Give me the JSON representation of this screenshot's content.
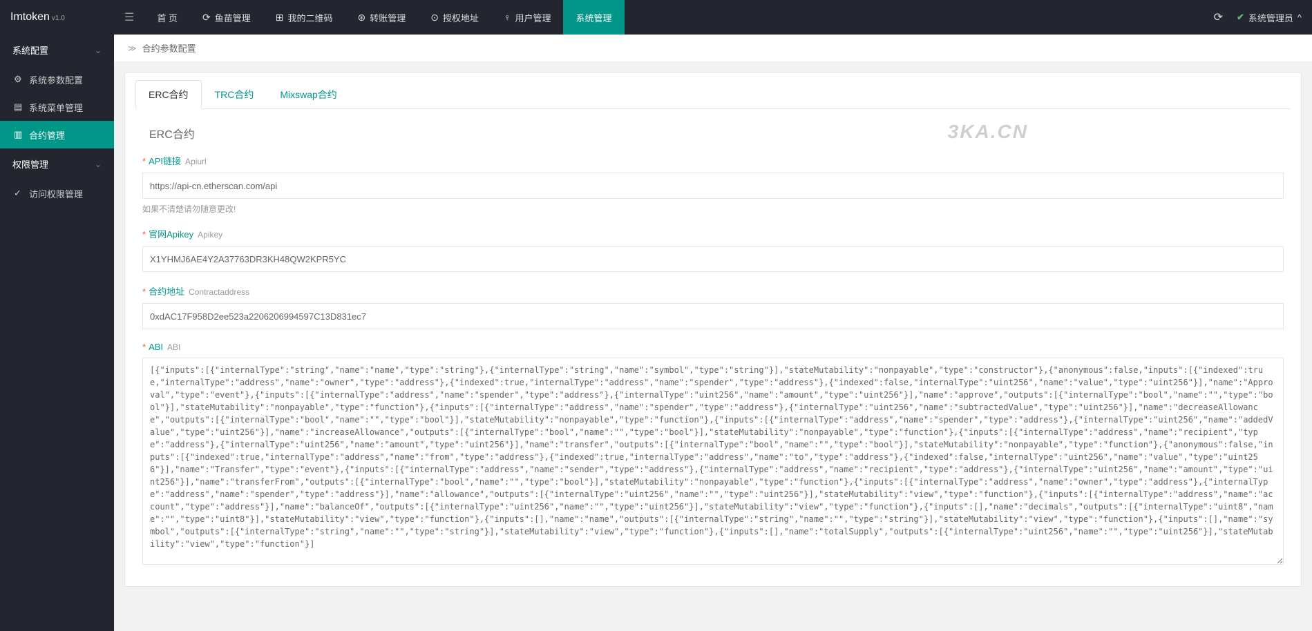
{
  "app": {
    "name": "Imtoken",
    "version": "v1.0"
  },
  "header": {
    "nav": [
      {
        "icon": "",
        "label": "首 页"
      },
      {
        "icon": "⟳",
        "label": "鱼苗管理"
      },
      {
        "icon": "⊞",
        "label": "我的二维码"
      },
      {
        "icon": "⊛",
        "label": "转账管理"
      },
      {
        "icon": "⊙",
        "label": "授权地址"
      },
      {
        "icon": "♀",
        "label": "用户管理"
      },
      {
        "icon": "",
        "label": "系统管理"
      }
    ],
    "user": "系统管理员"
  },
  "sidebar": {
    "group1": {
      "title": "系统配置"
    },
    "items1": [
      {
        "icon": "⚙",
        "label": "系统参数配置"
      },
      {
        "icon": "▤",
        "label": "系统菜单管理"
      },
      {
        "icon": "▥",
        "label": "合约管理"
      }
    ],
    "group2": {
      "title": "权限管理"
    },
    "items2": [
      {
        "icon": "✓",
        "label": "访问权限管理"
      }
    ]
  },
  "breadcrumb": "合约参数配置",
  "tabs": [
    {
      "label": "ERC合约"
    },
    {
      "label": "TRC合约"
    },
    {
      "label": "Mixswap合约"
    }
  ],
  "form": {
    "title": "ERC合约",
    "fields": {
      "apiurl": {
        "label": "API链接",
        "sub": "Apiurl",
        "value": "https://api-cn.etherscan.com/api",
        "hint": "如果不清楚请勿随意更改!"
      },
      "apikey": {
        "label": "官网Apikey",
        "sub": "Apikey",
        "value": "X1YHMJ6AE4Y2A37763DR3KH48QW2KPR5YC"
      },
      "contract": {
        "label": "合约地址",
        "sub": "Contractaddress",
        "value": "0xdAC17F958D2ee523a2206206994597C13D831ec7"
      },
      "abi": {
        "label": "ABI",
        "sub": "ABI",
        "value": "[{\"inputs\":[{\"internalType\":\"string\",\"name\":\"name\",\"type\":\"string\"},{\"internalType\":\"string\",\"name\":\"symbol\",\"type\":\"string\"}],\"stateMutability\":\"nonpayable\",\"type\":\"constructor\"},{\"anonymous\":false,\"inputs\":[{\"indexed\":true,\"internalType\":\"address\",\"name\":\"owner\",\"type\":\"address\"},{\"indexed\":true,\"internalType\":\"address\",\"name\":\"spender\",\"type\":\"address\"},{\"indexed\":false,\"internalType\":\"uint256\",\"name\":\"value\",\"type\":\"uint256\"}],\"name\":\"Approval\",\"type\":\"event\"},{\"inputs\":[{\"internalType\":\"address\",\"name\":\"spender\",\"type\":\"address\"},{\"internalType\":\"uint256\",\"name\":\"amount\",\"type\":\"uint256\"}],\"name\":\"approve\",\"outputs\":[{\"internalType\":\"bool\",\"name\":\"\",\"type\":\"bool\"}],\"stateMutability\":\"nonpayable\",\"type\":\"function\"},{\"inputs\":[{\"internalType\":\"address\",\"name\":\"spender\",\"type\":\"address\"},{\"internalType\":\"uint256\",\"name\":\"subtractedValue\",\"type\":\"uint256\"}],\"name\":\"decreaseAllowance\",\"outputs\":[{\"internalType\":\"bool\",\"name\":\"\",\"type\":\"bool\"}],\"stateMutability\":\"nonpayable\",\"type\":\"function\"},{\"inputs\":[{\"internalType\":\"address\",\"name\":\"spender\",\"type\":\"address\"},{\"internalType\":\"uint256\",\"name\":\"addedValue\",\"type\":\"uint256\"}],\"name\":\"increaseAllowance\",\"outputs\":[{\"internalType\":\"bool\",\"name\":\"\",\"type\":\"bool\"}],\"stateMutability\":\"nonpayable\",\"type\":\"function\"},{\"inputs\":[{\"internalType\":\"address\",\"name\":\"recipient\",\"type\":\"address\"},{\"internalType\":\"uint256\",\"name\":\"amount\",\"type\":\"uint256\"}],\"name\":\"transfer\",\"outputs\":[{\"internalType\":\"bool\",\"name\":\"\",\"type\":\"bool\"}],\"stateMutability\":\"nonpayable\",\"type\":\"function\"},{\"anonymous\":false,\"inputs\":[{\"indexed\":true,\"internalType\":\"address\",\"name\":\"from\",\"type\":\"address\"},{\"indexed\":true,\"internalType\":\"address\",\"name\":\"to\",\"type\":\"address\"},{\"indexed\":false,\"internalType\":\"uint256\",\"name\":\"value\",\"type\":\"uint256\"}],\"name\":\"Transfer\",\"type\":\"event\"},{\"inputs\":[{\"internalType\":\"address\",\"name\":\"sender\",\"type\":\"address\"},{\"internalType\":\"address\",\"name\":\"recipient\",\"type\":\"address\"},{\"internalType\":\"uint256\",\"name\":\"amount\",\"type\":\"uint256\"}],\"name\":\"transferFrom\",\"outputs\":[{\"internalType\":\"bool\",\"name\":\"\",\"type\":\"bool\"}],\"stateMutability\":\"nonpayable\",\"type\":\"function\"},{\"inputs\":[{\"internalType\":\"address\",\"name\":\"owner\",\"type\":\"address\"},{\"internalType\":\"address\",\"name\":\"spender\",\"type\":\"address\"}],\"name\":\"allowance\",\"outputs\":[{\"internalType\":\"uint256\",\"name\":\"\",\"type\":\"uint256\"}],\"stateMutability\":\"view\",\"type\":\"function\"},{\"inputs\":[{\"internalType\":\"address\",\"name\":\"account\",\"type\":\"address\"}],\"name\":\"balanceOf\",\"outputs\":[{\"internalType\":\"uint256\",\"name\":\"\",\"type\":\"uint256\"}],\"stateMutability\":\"view\",\"type\":\"function\"},{\"inputs\":[],\"name\":\"decimals\",\"outputs\":[{\"internalType\":\"uint8\",\"name\":\"\",\"type\":\"uint8\"}],\"stateMutability\":\"view\",\"type\":\"function\"},{\"inputs\":[],\"name\":\"name\",\"outputs\":[{\"internalType\":\"string\",\"name\":\"\",\"type\":\"string\"}],\"stateMutability\":\"view\",\"type\":\"function\"},{\"inputs\":[],\"name\":\"symbol\",\"outputs\":[{\"internalType\":\"string\",\"name\":\"\",\"type\":\"string\"}],\"stateMutability\":\"view\",\"type\":\"function\"},{\"inputs\":[],\"name\":\"totalSupply\",\"outputs\":[{\"internalType\":\"uint256\",\"name\":\"\",\"type\":\"uint256\"}],\"stateMutability\":\"view\",\"type\":\"function\"}]"
      }
    }
  },
  "watermark": "3KA.CN"
}
